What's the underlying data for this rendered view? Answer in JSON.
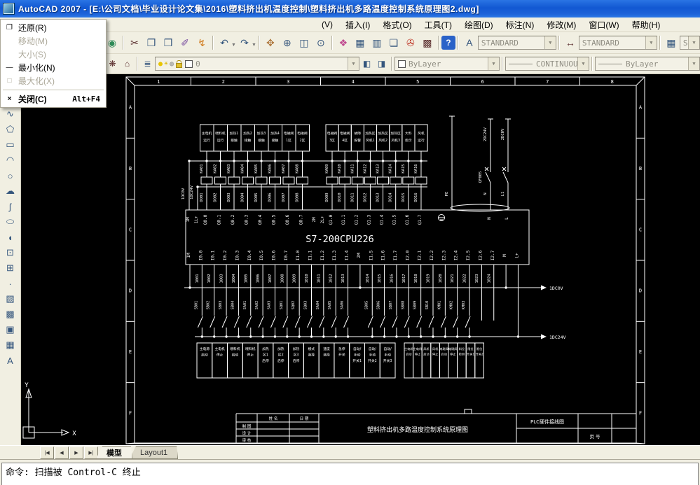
{
  "window": {
    "title": "AutoCAD 2007 - [E:\\公司文档\\毕业设计论文集\\2016\\塑料挤出机温度控制\\塑料挤出机多路温度控制系统原理图2.dwg]"
  },
  "menu_bar": {
    "items": [
      "(V)",
      "插入(I)",
      "格式(O)",
      "工具(T)",
      "绘图(D)",
      "标注(N)",
      "修改(M)",
      "窗口(W)",
      "帮助(H)"
    ]
  },
  "context_menu": {
    "items": [
      {
        "label": "还原(R)",
        "enabled": true,
        "icon": "restore",
        "shortcut": ""
      },
      {
        "label": "移动(M)",
        "enabled": false,
        "icon": "",
        "shortcut": ""
      },
      {
        "label": "大小(S)",
        "enabled": false,
        "icon": "",
        "shortcut": ""
      },
      {
        "label": "最小化(N)",
        "enabled": true,
        "icon": "minimize",
        "shortcut": ""
      },
      {
        "label": "最大化(X)",
        "enabled": false,
        "icon": "maximize",
        "shortcut": ""
      },
      {
        "label": "关闭(C)",
        "enabled": true,
        "icon": "close",
        "shortcut": "Alt+F4"
      }
    ]
  },
  "toolbars": {
    "text_style": "STANDARD",
    "dim_style": "STANDARD",
    "table_style": "Standard",
    "layer_name": "0",
    "color": "ByLayer",
    "linetype": "CONTINUOUS",
    "lineweight": "ByLayer"
  },
  "tabs": {
    "model": "模型",
    "layout1": "Layout1"
  },
  "command_line": {
    "text": "命令: 扫描被 Control-C 终止"
  },
  "drawing": {
    "plc_label": "S7-200CPU226",
    "top_terminals": [
      "1M",
      "1L+",
      "Q0.0",
      "Q0.1",
      "Q0.2",
      "Q0.3",
      "Q0.4",
      "Q0.5",
      "Q0.6",
      "Q0.7",
      "2M",
      "2L+",
      "Q1.0",
      "Q1.1",
      "Q1.2",
      "Q1.3",
      "Q1.4",
      "Q1.5",
      "Q1.6",
      "Q1.7"
    ],
    "power_terminals": [
      "N",
      "L"
    ],
    "bottom_terminals": [
      "1M",
      "I0.0",
      "I0.1",
      "I0.2",
      "I0.3",
      "I0.4",
      "I0.5",
      "I0.6",
      "I0.7",
      "I1.0",
      "I1.1",
      "I1.2",
      "I1.3",
      "I1.4",
      "2M",
      "I1.5",
      "I1.6",
      "I1.7",
      "I2.0",
      "I2.1",
      "I2.2",
      "I2.3",
      "I2.4",
      "I2.5",
      "I2.6",
      "I2.7",
      "M",
      "L+"
    ],
    "relays": [
      "KA01",
      "KA02",
      "KA03",
      "KA04",
      "KA05",
      "KA06",
      "KA07",
      "KA08",
      "KA09",
      "KA10",
      "KA11",
      "KA12",
      "KA13",
      "KA14",
      "KA15",
      "KA16"
    ],
    "output_wires": [
      "DO01",
      "DO02",
      "DO03",
      "DO04",
      "DO05",
      "DO06",
      "DO07",
      "DO08",
      "DO09",
      "DO10",
      "DO11",
      "DO12",
      "DO13",
      "DO14",
      "DO15",
      "DO16"
    ],
    "output_loads": [
      "主电机\n运行",
      "喂料机\n运行",
      "加热1\n接触",
      "加热2\n接触",
      "加热3\n接触",
      "加热4\n接触",
      "电磁阀\n1区",
      "电磁阀\n2区",
      "电磁阀\n3区",
      "电磁阀\n4区",
      "故障\n报警",
      "加热区\n风机1",
      "加热区\n风机2",
      "加热区\n风机3",
      "大料\n指示",
      "风机\n运行"
    ],
    "input_wires": [
      "1001",
      "1002",
      "1003",
      "1004",
      "1005",
      "1006",
      "1007",
      "1008",
      "1009",
      "1010",
      "1011",
      "1012",
      "1013",
      "1014",
      "1015",
      "1016",
      "1017",
      "1018",
      "1019",
      "1020",
      "1021",
      "1022",
      "1023",
      "1024"
    ],
    "input_switches": [
      "SB01",
      "SB02",
      "SB03",
      "SB04",
      "SA01",
      "SA02",
      "SA03",
      "SQ01",
      "SQ02",
      "SQ03",
      "SA04",
      "SA05",
      "SA06",
      "SB05",
      "SB06",
      "SB07",
      "SB08",
      "SB09",
      "SB10",
      "KM01",
      "KM02",
      "KM03"
    ],
    "input_devices_left": [
      "主电源\n启动",
      "主电机\n停止",
      "喂料机\n启动",
      "喂料机\n停止",
      "加热\n区1\n启停",
      "加热\n区2\n启停",
      "加热\n区3\n启停",
      "模式\n选择",
      "速度\n选择",
      "急停\n开关",
      "自动/\n手动\n开关1",
      "自动/\n手动\n开关2",
      "自动/\n手动\n开关3"
    ],
    "input_devices_right": [
      "主电机\n启动",
      "主电机\n停止",
      "风机\n启动",
      "风机\n停止",
      "电磁阀\n启动",
      "电磁阀\n停止",
      "料位\n检测",
      "限位\n开关1",
      "限位\n开关2"
    ],
    "left_rails": [
      "1DC0V",
      "1DC24V"
    ],
    "right_rails": [
      "2DC24V",
      "2DC0V"
    ],
    "breaker": "QF005",
    "supply_labels": [
      "PE",
      "N",
      "L1"
    ],
    "bus_arrows": [
      "1DC0V",
      "1DC24V"
    ],
    "zones_cols": [
      "1",
      "2",
      "3",
      "4",
      "5",
      "6",
      "7",
      "8"
    ],
    "zones_rows": [
      "A",
      "B",
      "C",
      "D",
      "E",
      "F"
    ],
    "title_block": {
      "title": "塑料挤出机多路温度控制系统原理图",
      "doc_name": "PLC硬件接线图",
      "page_no": "页 号",
      "col_name": "姓 名",
      "col_date": "日 期",
      "row_labels": [
        "制 图",
        "设 计",
        "审 核"
      ]
    },
    "ucs_axes": [
      "X",
      "Y"
    ]
  }
}
